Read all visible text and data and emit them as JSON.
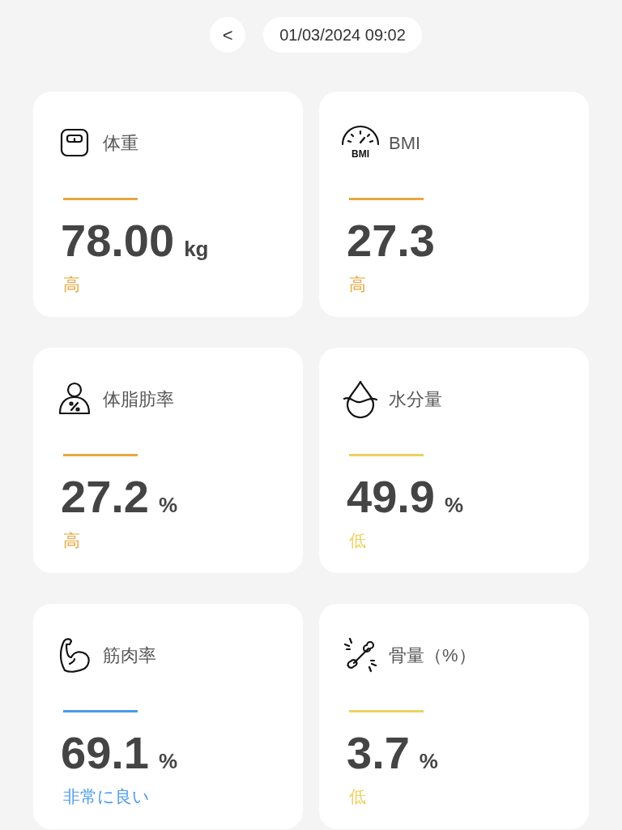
{
  "header": {
    "back": "<",
    "date": "01/03/2024 09:02"
  },
  "cards": [
    {
      "kind": "scale",
      "label": "体重",
      "value": "78.00",
      "unit": "kg",
      "status": "高",
      "color": "#e8a73e"
    },
    {
      "kind": "gauge",
      "icon_text": "BMI",
      "label": "BMI",
      "value": "27.3",
      "status": "高",
      "color": "#e8a73e"
    },
    {
      "kind": "fat",
      "label": "体脂肪率",
      "value": "27.2",
      "unit": "%",
      "status": "高",
      "color": "#e8a73e"
    },
    {
      "kind": "drop",
      "label": "水分量",
      "value": "49.9",
      "unit": "%",
      "status": "低",
      "color": "#eed160"
    },
    {
      "kind": "muscle",
      "label": "筋肉率",
      "value": "69.1",
      "unit": "%",
      "status": "非常に良い",
      "color": "#4b9be8"
    },
    {
      "kind": "bone",
      "label": "骨量（%）",
      "value": "3.7",
      "unit": "%",
      "status": "低",
      "color": "#eed160"
    }
  ]
}
